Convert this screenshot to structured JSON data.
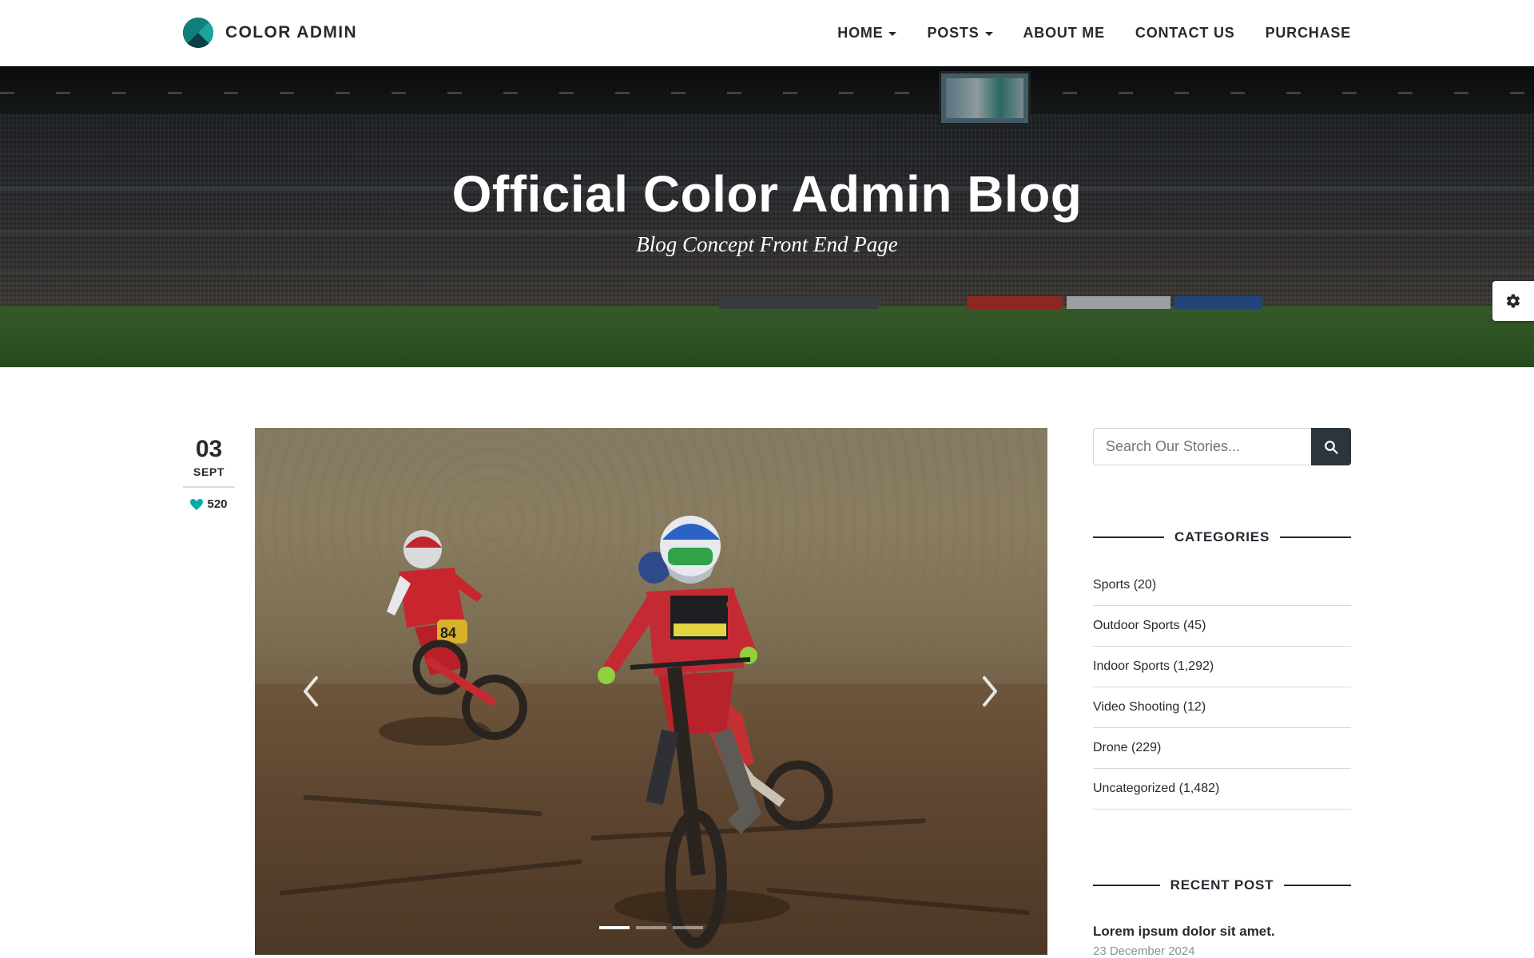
{
  "header": {
    "brand": "COLOR ADMIN",
    "nav": [
      {
        "label": "HOME",
        "dropdown": true
      },
      {
        "label": "POSTS",
        "dropdown": true
      },
      {
        "label": "ABOUT ME",
        "dropdown": false
      },
      {
        "label": "CONTACT US",
        "dropdown": false
      },
      {
        "label": "PURCHASE",
        "dropdown": false
      }
    ]
  },
  "hero": {
    "title": "Official Color Admin Blog",
    "subtitle": "Blog Concept Front End Page"
  },
  "post": {
    "day": "03",
    "month": "SEPT",
    "likes": "520",
    "carousel": {
      "slide_count": 3,
      "active_slide": 1
    }
  },
  "sidebar": {
    "search": {
      "placeholder": "Search Our Stories..."
    },
    "categories_title": "CATEGORIES",
    "categories": [
      "Sports (20)",
      "Outdoor Sports (45)",
      "Indoor Sports (1,292)",
      "Video Shooting (12)",
      "Drone (229)",
      "Uncategorized (1,482)"
    ],
    "recent_title": "RECENT POST",
    "recent_posts": [
      {
        "title": "Lorem ipsum dolor sit amet.",
        "date": "23 December 2024"
      }
    ]
  },
  "colors": {
    "accent": "#00acac",
    "dark": "#2d353c",
    "text": "#242a30"
  },
  "icons": {
    "settings": "gear-icon",
    "search": "search-icon",
    "likes": "heart-icon"
  }
}
